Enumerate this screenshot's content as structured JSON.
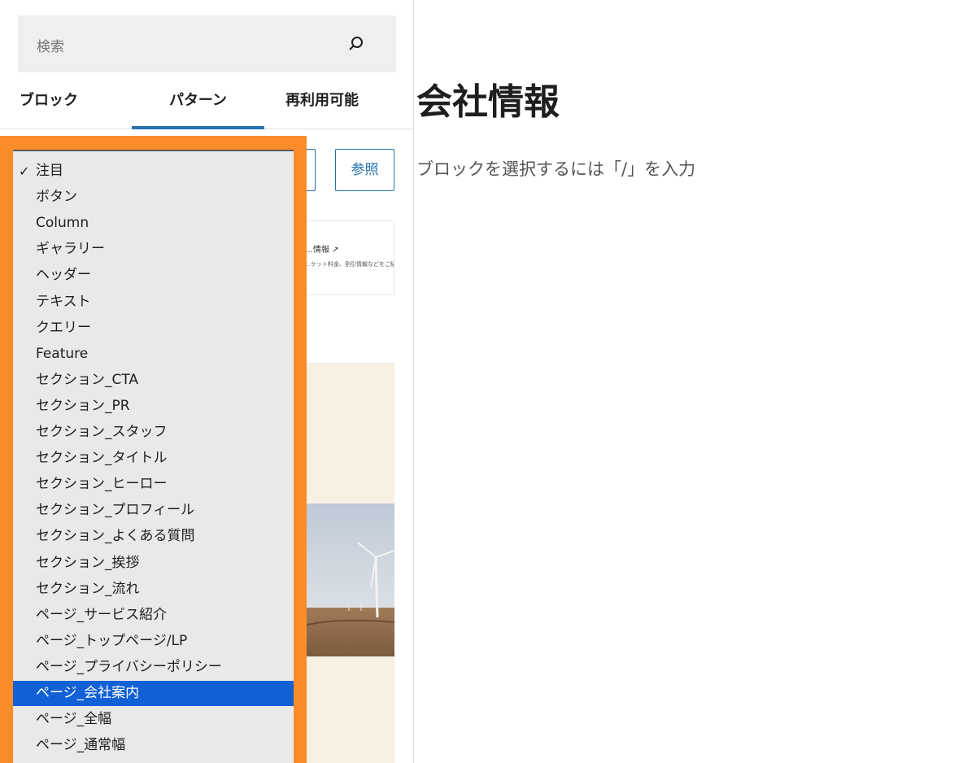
{
  "sidebar": {
    "search": {
      "placeholder": "検索"
    },
    "tabs": [
      {
        "label": "ブロック"
      },
      {
        "label": "パターン"
      },
      {
        "label": "再利用可能"
      }
    ],
    "browse_label": "参照",
    "preview_card": {
      "title": "…情報 ↗",
      "subtitle": "…ケット料金、割引情報などをご紹"
    }
  },
  "dropdown": {
    "options": [
      {
        "label": "注目",
        "checked": true
      },
      {
        "label": "ボタン"
      },
      {
        "label": "Column"
      },
      {
        "label": "ギャラリー"
      },
      {
        "label": "ヘッダー"
      },
      {
        "label": "テキスト"
      },
      {
        "label": "クエリー"
      },
      {
        "label": "Feature"
      },
      {
        "label": "セクション_CTA"
      },
      {
        "label": "セクション_PR"
      },
      {
        "label": "セクション_スタッフ"
      },
      {
        "label": "セクション_タイトル"
      },
      {
        "label": "セクション_ヒーロー"
      },
      {
        "label": "セクション_プロフィール"
      },
      {
        "label": "セクション_よくある質問"
      },
      {
        "label": "セクション_挨拶"
      },
      {
        "label": "セクション_流れ"
      },
      {
        "label": "ページ_サービス紹介"
      },
      {
        "label": "ページ_トップページ/LP"
      },
      {
        "label": "ページ_プライバシーポリシー"
      },
      {
        "label": "ページ_会社案内",
        "highlighted": true
      },
      {
        "label": "ページ_全幅"
      },
      {
        "label": "ページ_通常幅"
      }
    ],
    "check_mark": "✓",
    "highlight_color": "#1160d6",
    "frame_color": "#fb8c2a"
  },
  "editor": {
    "title": "会社情報",
    "placeholder": "ブロックを選択するには「/」を入力"
  }
}
